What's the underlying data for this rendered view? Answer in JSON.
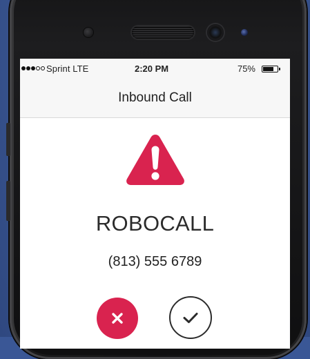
{
  "status_bar": {
    "signal_filled": 3,
    "signal_total": 5,
    "carrier": "Sprint  LTE",
    "time": "2:20 PM",
    "battery_pct": "75%",
    "battery_level": 0.75
  },
  "nav": {
    "title": "Inbound Call"
  },
  "call": {
    "warning_icon": "warning-triangle-icon",
    "caller_label": "ROBOCALL",
    "caller_number": "(813) 555 6789"
  },
  "actions": {
    "decline_icon": "close-icon",
    "accept_icon": "checkmark-icon"
  },
  "colors": {
    "alert": "#d9234f",
    "background": "#3a5796"
  }
}
